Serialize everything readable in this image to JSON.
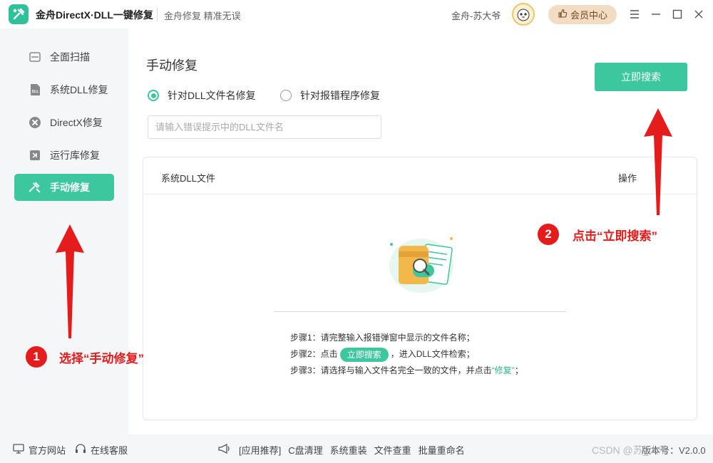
{
  "titlebar": {
    "app_name": "金舟DirectX·DLL一键修复",
    "slogan": "金舟修复 精准无误",
    "user_name": "金舟-苏大爷",
    "vip_label": "会员中心"
  },
  "sidebar": {
    "items": [
      {
        "label": "全面扫描"
      },
      {
        "label": "系统DLL修复"
      },
      {
        "label": "DirectX修复"
      },
      {
        "label": "运行库修复"
      },
      {
        "label": "手动修复"
      }
    ]
  },
  "main": {
    "title": "手动修复",
    "radio_dll": "针对DLL文件名修复",
    "radio_program": "针对报错程序修复",
    "search_placeholder": "请输入错误提示中的DLL文件名",
    "search_button": "立即搜索",
    "table": {
      "col_name": "系统DLL文件",
      "col_op": "操作"
    },
    "steps": {
      "s1": "步骤1：请完整输入报错弹窗中显示的文件名称；",
      "s2_pre": "步骤2：点击",
      "s2_btn": "立即搜索",
      "s2_post": "，进入DLL文件检索；",
      "s3_pre": "步骤3：请选择与输入文件名完全一致的文件，并点击",
      "s3_link": "“修复”",
      "s3_post": "；"
    }
  },
  "footer": {
    "website": "官方网站",
    "support": "在线客服",
    "tools": [
      "[应用推荐]",
      "C盘清理",
      "系统重装",
      "文件查重",
      "批量重命名"
    ],
    "version": "版本号：V2.0.0"
  },
  "watermark": "CSDN @苏_大爷",
  "annotations": {
    "n1": "1",
    "t1": "选择“手动修复”",
    "n2": "2",
    "t2": "点击“立即搜索”"
  },
  "colors": {
    "accent": "#3cc79e",
    "annotation": "#e51c1c",
    "vip": "#f2dcc4"
  }
}
